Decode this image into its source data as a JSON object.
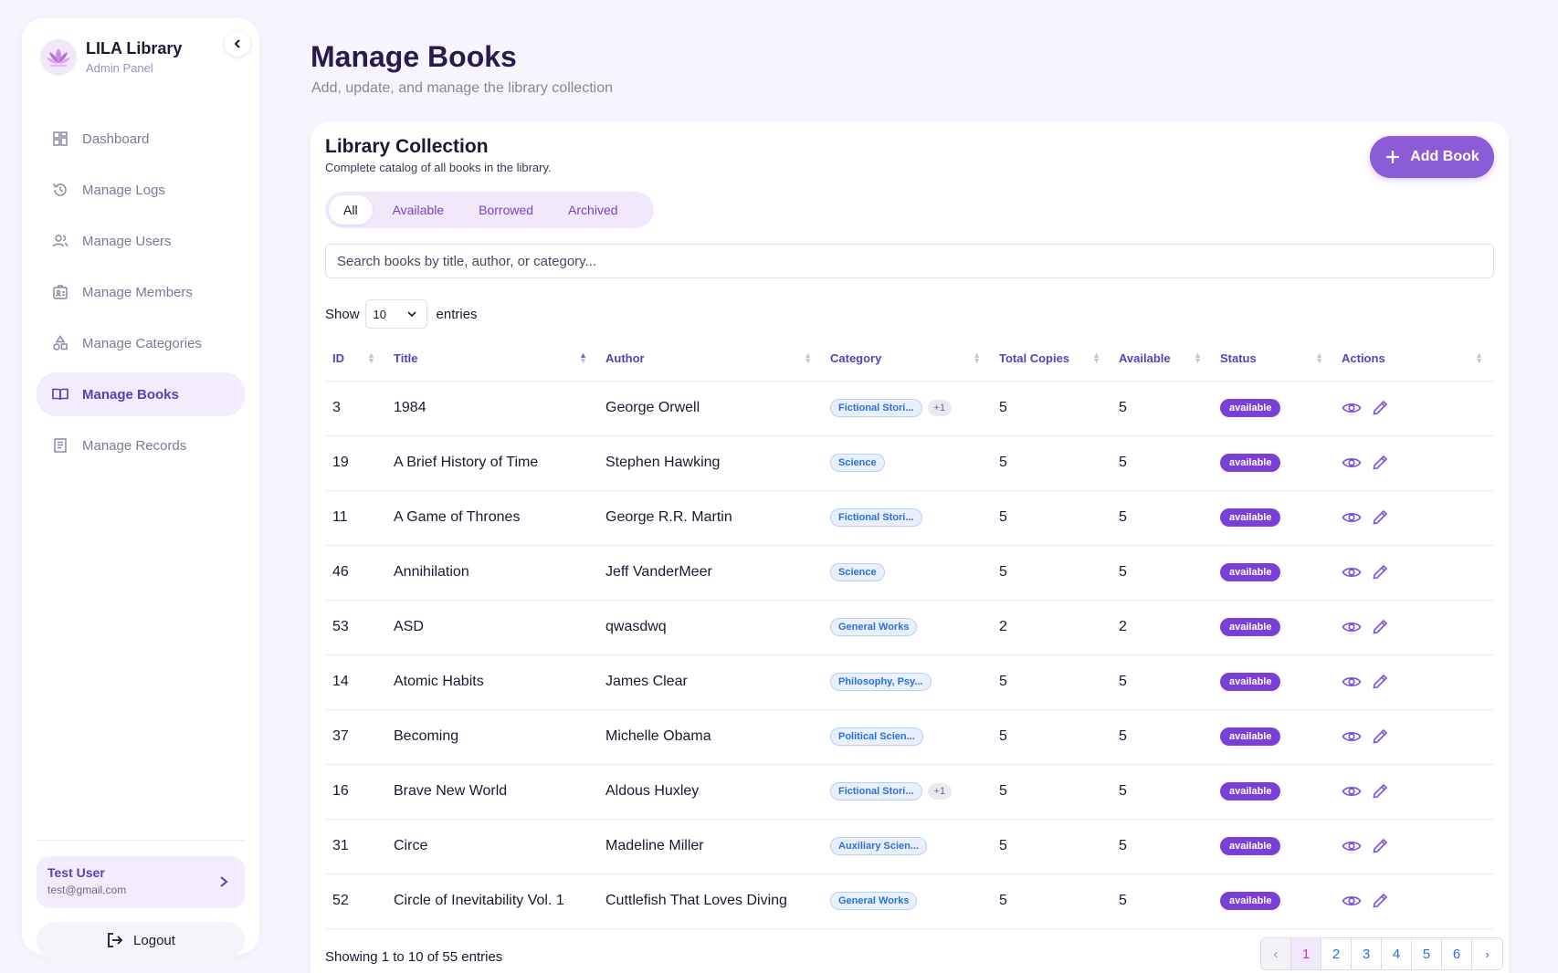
{
  "sidebar": {
    "brand_title": "LILA Library",
    "brand_subtitle": "Admin Panel",
    "items": [
      {
        "label": "Dashboard",
        "icon": "dashboard-icon"
      },
      {
        "label": "Manage Logs",
        "icon": "history-icon"
      },
      {
        "label": "Manage Users",
        "icon": "users-icon"
      },
      {
        "label": "Manage Members",
        "icon": "id-card-icon"
      },
      {
        "label": "Manage Categories",
        "icon": "shapes-icon"
      },
      {
        "label": "Manage Books",
        "icon": "book-open-icon",
        "active": true
      },
      {
        "label": "Manage Records",
        "icon": "receipt-icon"
      }
    ],
    "user_name": "Test User",
    "user_email": "test@gmail.com",
    "logout_label": "Logout"
  },
  "header": {
    "title": "Manage Books",
    "subtitle": "Add, update, and manage the library collection"
  },
  "collection": {
    "title": "Library Collection",
    "subtitle": "Complete catalog of all books in the library.",
    "add_label": "Add Book",
    "tabs": [
      "All",
      "Available",
      "Borrowed",
      "Archived"
    ],
    "search_placeholder": "Search books by title, author, or category...",
    "show_label": "Show",
    "entries_value": "10",
    "entries_label": "entries"
  },
  "table": {
    "columns": [
      "ID",
      "Title",
      "Author",
      "Category",
      "Total Copies",
      "Available",
      "Status",
      "Actions"
    ],
    "rows": [
      {
        "id": "3",
        "title": "1984",
        "author": "George Orwell",
        "category": "Fictional Stori...",
        "more": "+1",
        "total": "5",
        "available": "5",
        "status": "available"
      },
      {
        "id": "19",
        "title": "A Brief History of Time",
        "author": "Stephen Hawking",
        "category": "Science",
        "more": "",
        "total": "5",
        "available": "5",
        "status": "available"
      },
      {
        "id": "11",
        "title": "A Game of Thrones",
        "author": "George R.R. Martin",
        "category": "Fictional Stori...",
        "more": "",
        "total": "5",
        "available": "5",
        "status": "available"
      },
      {
        "id": "46",
        "title": "Annihilation",
        "author": "Jeff VanderMeer",
        "category": "Science",
        "more": "",
        "total": "5",
        "available": "5",
        "status": "available"
      },
      {
        "id": "53",
        "title": "ASD",
        "author": "qwasdwq",
        "category": "General Works",
        "more": "",
        "total": "2",
        "available": "2",
        "status": "available"
      },
      {
        "id": "14",
        "title": "Atomic Habits",
        "author": "James Clear",
        "category": "Philosophy, Psy...",
        "more": "",
        "total": "5",
        "available": "5",
        "status": "available"
      },
      {
        "id": "37",
        "title": "Becoming",
        "author": "Michelle Obama",
        "category": "Political Scien...",
        "more": "",
        "total": "5",
        "available": "5",
        "status": "available"
      },
      {
        "id": "16",
        "title": "Brave New World",
        "author": "Aldous Huxley",
        "category": "Fictional Stori...",
        "more": "+1",
        "total": "5",
        "available": "5",
        "status": "available"
      },
      {
        "id": "31",
        "title": "Circe",
        "author": "Madeline Miller",
        "category": "Auxiliary Scien...",
        "more": "",
        "total": "5",
        "available": "5",
        "status": "available"
      },
      {
        "id": "52",
        "title": "Circle of Inevitability Vol. 1",
        "author": "Cuttlefish That Loves Diving",
        "category": "General Works",
        "more": "",
        "total": "5",
        "available": "5",
        "status": "available"
      }
    ]
  },
  "footer": {
    "showing": "Showing 1 to 10 of 55 entries",
    "prev": "‹",
    "pages": [
      "1",
      "2",
      "3",
      "4",
      "5",
      "6"
    ],
    "next": "›"
  },
  "colors": {
    "accent": "#8b5cd6",
    "status_badge": "#7a3fd6",
    "category_badge_text": "#2f6fd6"
  }
}
